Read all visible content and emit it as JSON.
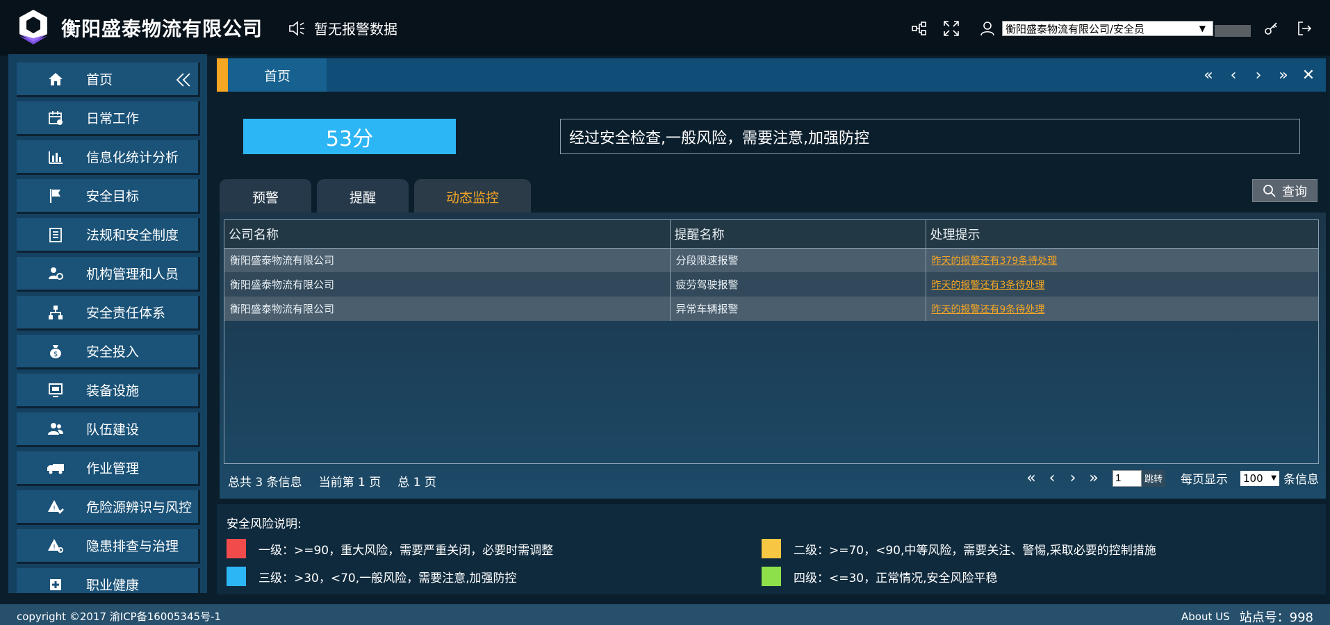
{
  "header": {
    "company_name": "衡阳盛泰物流有限公司",
    "alarm_text": "暂无报警数据",
    "user_select_value": "衡阳盛泰物流有限公司/安全员"
  },
  "sidebar": {
    "items": [
      {
        "label": "首页",
        "icon": "home-icon"
      },
      {
        "label": "日常工作",
        "icon": "calendar-icon"
      },
      {
        "label": "信息化统计分析",
        "icon": "bar-chart-icon"
      },
      {
        "label": "安全目标",
        "icon": "flag-icon"
      },
      {
        "label": "法规和安全制度",
        "icon": "document-icon"
      },
      {
        "label": "机构管理和人员",
        "icon": "user-gear-icon"
      },
      {
        "label": "安全责任体系",
        "icon": "hierarchy-icon"
      },
      {
        "label": "安全投入",
        "icon": "money-bag-icon"
      },
      {
        "label": "装备设施",
        "icon": "monitor-icon"
      },
      {
        "label": "队伍建设",
        "icon": "users-icon"
      },
      {
        "label": "作业管理",
        "icon": "truck-icon"
      },
      {
        "label": "危险源辨识与风控",
        "icon": "warning-edit-icon"
      },
      {
        "label": "隐患排查与治理",
        "icon": "warning-search-icon"
      },
      {
        "label": "职业健康",
        "icon": "health-icon"
      }
    ]
  },
  "tabbar": {
    "home_tab": "首页"
  },
  "score": {
    "value": "53分",
    "description": "经过安全检查,一般风险，需要注意,加强防控"
  },
  "subtabs": [
    {
      "label": "预警",
      "active": false
    },
    {
      "label": "提醒",
      "active": false
    },
    {
      "label": "动态监控",
      "active": true
    }
  ],
  "query_button": "查询",
  "table": {
    "columns": [
      "公司名称",
      "提醒名称",
      "处理提示"
    ],
    "rows": [
      {
        "company": "衡阳盛泰物流有限公司",
        "name": "分段限速报警",
        "tip": "昨天的报警还有379条待处理"
      },
      {
        "company": "衡阳盛泰物流有限公司",
        "name": "疲劳驾驶报警",
        "tip": "昨天的报警还有3条待处理"
      },
      {
        "company": "衡阳盛泰物流有限公司",
        "name": "异常车辆报警",
        "tip": "昨天的报警还有9条待处理"
      }
    ]
  },
  "pager": {
    "total": "总共 3 条信息",
    "current": "当前第 1 页",
    "pages": "总 1 页",
    "page_input": "1",
    "jump": "跳转",
    "per_page_label": "每页显示",
    "per_page_value": "100",
    "per_page_suffix": "条信息"
  },
  "legend": {
    "title": "安全风险说明:",
    "items": [
      {
        "color": "#f24b4b",
        "text": "一级：>=90，重大风险，需要严重关闭，必要时需调整"
      },
      {
        "color": "#f7c744",
        "text": "二级：>=70，<90,中等风险，需要关注、警惕,采取必要的控制措施"
      },
      {
        "color": "#2db6f5",
        "text": "三级：>30，<70,一般风险，需要注意,加强防控"
      },
      {
        "color": "#8ee04a",
        "text": "四级：<=30，正常情况,安全风险平稳"
      }
    ]
  },
  "footer": {
    "copyright": "copyright ©2017 渝ICP备16005345号-1",
    "about": "About US",
    "station": "站点号：998"
  }
}
